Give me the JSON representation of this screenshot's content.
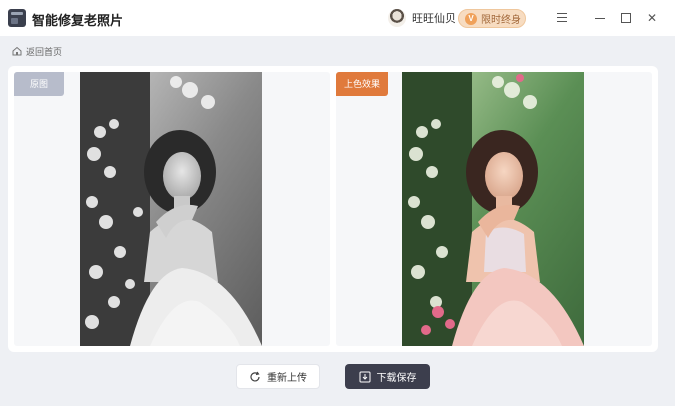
{
  "app": {
    "title": "智能修复老照片"
  },
  "user": {
    "name": "旺旺仙贝"
  },
  "vip": {
    "label": "限时终身",
    "icon": "diamond-vip-icon"
  },
  "window_controls": [
    "menu-icon",
    "minimize-icon",
    "maximize-icon",
    "close-icon"
  ],
  "nav": {
    "back_label": "返回首页",
    "back_icon": "home-icon"
  },
  "panels": {
    "left_tag": "原图",
    "right_tag": "上色效果"
  },
  "actions": {
    "reupload_label": "重新上传",
    "download_label": "下载保存"
  },
  "colors": {
    "accent_orange": "#e07a3c",
    "original_tag": "#b7bccb",
    "download_button": "#3c3e4d",
    "vip_badge": "#f7dcc1"
  }
}
